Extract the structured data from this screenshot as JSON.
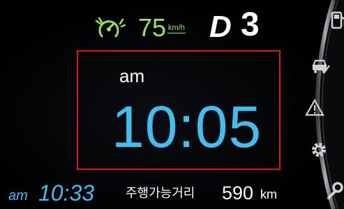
{
  "cluster": {
    "speed": "75",
    "speed_unit": "km/h",
    "gear_mode": "D",
    "gear_number": "3",
    "clock": {
      "ampm": "am",
      "time": "10:05"
    },
    "bottom_clock": {
      "ampm": "am",
      "time": "10:33"
    },
    "range": {
      "label": "주행가능거리",
      "value": "590",
      "unit": "km"
    },
    "highlight_color": "#e0161f",
    "accent_blue": "#42bdf0",
    "accent_green": "#9be25a"
  },
  "side_menu": {
    "icons": [
      "fuel-pump-icon",
      "car-road-icon",
      "warning-triangle-icon",
      "settings-gear-icon",
      "wrench-icon"
    ]
  }
}
